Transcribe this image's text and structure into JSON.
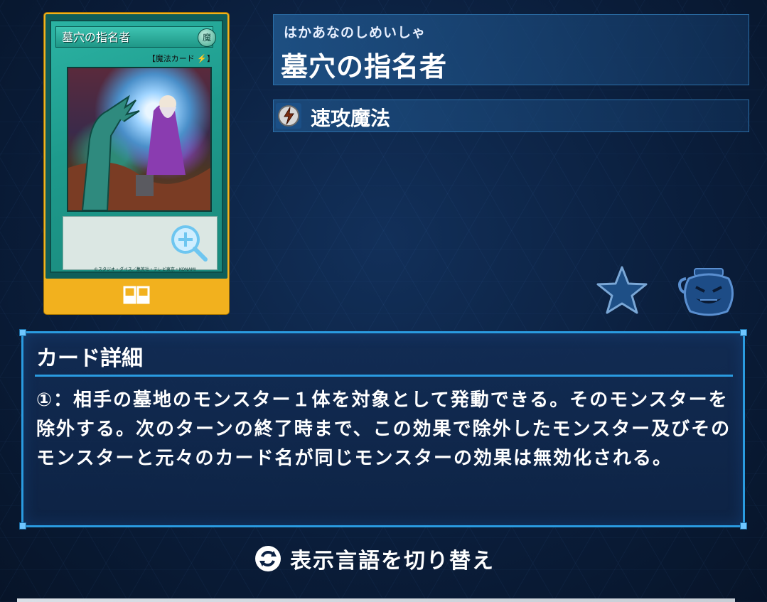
{
  "card": {
    "name": "墓穴の指名者",
    "attribute": "魔",
    "type_line": "【魔法カード ⚡】",
    "copyright": "©スタジオ・ダイス／集英社・テレビ東京・KONAMI"
  },
  "header": {
    "ruby": "はかあなのしめいしゃ",
    "title": "墓穴の指名者"
  },
  "type": {
    "label": "速攻魔法",
    "icon": "quick-play-spell-icon"
  },
  "actions": {
    "favorite_icon": "star-icon",
    "pot_icon": "pot-of-greed-icon"
  },
  "details": {
    "heading": "カード詳細",
    "text": "①：相手の墓地のモンスター１体を対象として発動できる。そのモンスターを除外する。次のターンの終了時まで、この効果で除外したモンスター及びそのモンスターと元々のカード名が同じモンスターの効果は無効化される。"
  },
  "language_toggle": {
    "label": "表示言語を切り替え"
  },
  "colors": {
    "card_frame": "#f2b11e",
    "accent": "#2a9be0",
    "background": "#0a1d3a"
  }
}
